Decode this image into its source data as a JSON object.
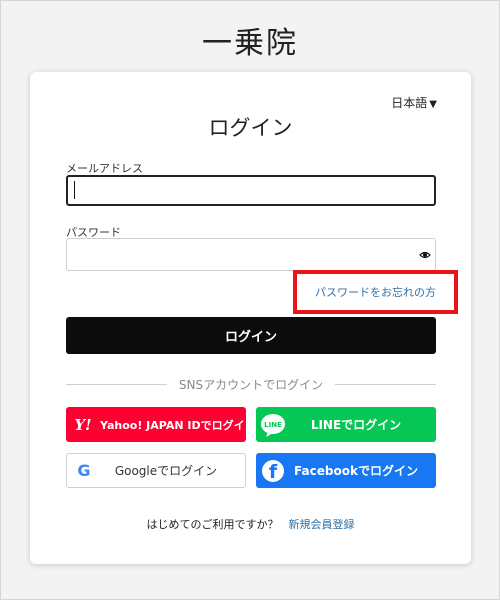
{
  "site": {
    "title": "一乗院"
  },
  "language": {
    "label": "日本語",
    "caret": "▼"
  },
  "login_card": {
    "title": "ログイン",
    "email": {
      "label": "メールアドレス",
      "value": ""
    },
    "password": {
      "label": "パスワード",
      "value": ""
    },
    "forgot_link": "パスワードをお忘れの方",
    "login_button": "ログイン",
    "sns_divider": "SNSアカウントでログイン"
  },
  "sns": {
    "yahoo": {
      "label": "Yahoo! JAPAN IDでログイン",
      "icon_text": "Y!",
      "color": "#ff0033"
    },
    "line": {
      "label": "LINEでログイン",
      "icon_text": "LINE",
      "color": "#06c755"
    },
    "google": {
      "label": "Googleでログイン",
      "icon_text": "G"
    },
    "facebook": {
      "label": "Facebookでログイン",
      "icon_text": "f",
      "color": "#1877f2"
    }
  },
  "signup": {
    "prompt": "はじめてのご利用ですか？",
    "link": "新規会員登録"
  },
  "colors": {
    "highlight": "#e8131b",
    "link": "#2f6fa4",
    "button": "#0c0c0c"
  }
}
